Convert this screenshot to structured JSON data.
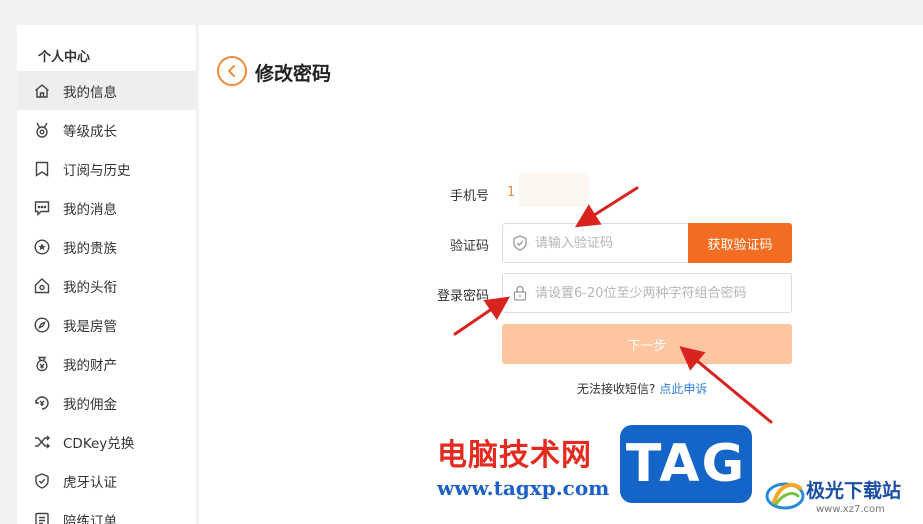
{
  "sidebar": {
    "title": "个人中心",
    "items": [
      {
        "label": "我的信息",
        "icon": "home-icon",
        "active": true
      },
      {
        "label": "等级成长",
        "icon": "medal-icon"
      },
      {
        "label": "订阅与历史",
        "icon": "bookmark-icon"
      },
      {
        "label": "我的消息",
        "icon": "message-icon"
      },
      {
        "label": "我的贵族",
        "icon": "star-circle-icon"
      },
      {
        "label": "我的头衔",
        "icon": "badge-home-icon"
      },
      {
        "label": "我是房管",
        "icon": "compass-icon"
      },
      {
        "label": "我的财产",
        "icon": "money-bag-icon"
      },
      {
        "label": "我的佣金",
        "icon": "coin-exchange-icon"
      },
      {
        "label": "CDKey兑换",
        "icon": "shuffle-icon"
      },
      {
        "label": "虎牙认证",
        "icon": "shield-check-icon"
      },
      {
        "label": "陪练订单",
        "icon": "order-list-icon"
      }
    ]
  },
  "main": {
    "title": "修改密码",
    "form": {
      "phone_label": "手机号",
      "phone_value": "1",
      "code_label": "验证码",
      "code_placeholder": "请输入验证码",
      "get_code_button": "获取验证码",
      "password_label": "登录密码",
      "password_placeholder": "请设置6-20位至少两种字符组合密码",
      "next_button": "下一步",
      "help_text": "无法接收短信?",
      "help_link": "点此申诉"
    }
  },
  "watermarks": {
    "brand_cn": "电脑技术网",
    "brand_url": "www.tagxp.com",
    "tag": "TAG",
    "site_name": "极光下载站",
    "site_url": "www.xz7.com"
  },
  "colors": {
    "accent": "#f26d22",
    "next_button": "#fdc6a1",
    "link": "#2f7fd8",
    "annotation_arrow": "#d8231f"
  }
}
